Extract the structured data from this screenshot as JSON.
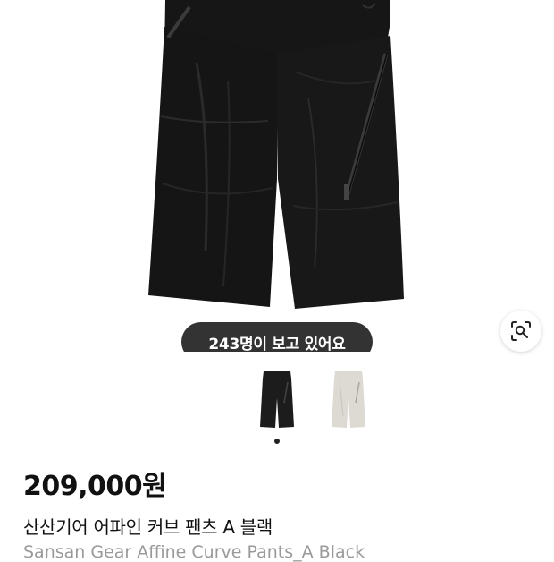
{
  "product": {
    "viewers_text": "243명이 보고 있어요",
    "price": "209,000원",
    "name_ko": "산산기어 어파인 커브 팬츠 A 블랙",
    "name_en": "Sansan Gear Affine Curve Pants_A Black"
  },
  "thumbnails": [
    {
      "label": "black",
      "color": "#1c1c1c"
    },
    {
      "label": "ivory",
      "color": "#dcdad3"
    }
  ],
  "carousel": {
    "total_dots": 1,
    "active_index": 0
  },
  "colors": {
    "pill_bg": "#333333",
    "active_dot": "#222222",
    "subtitle": "#9a9a9a"
  }
}
